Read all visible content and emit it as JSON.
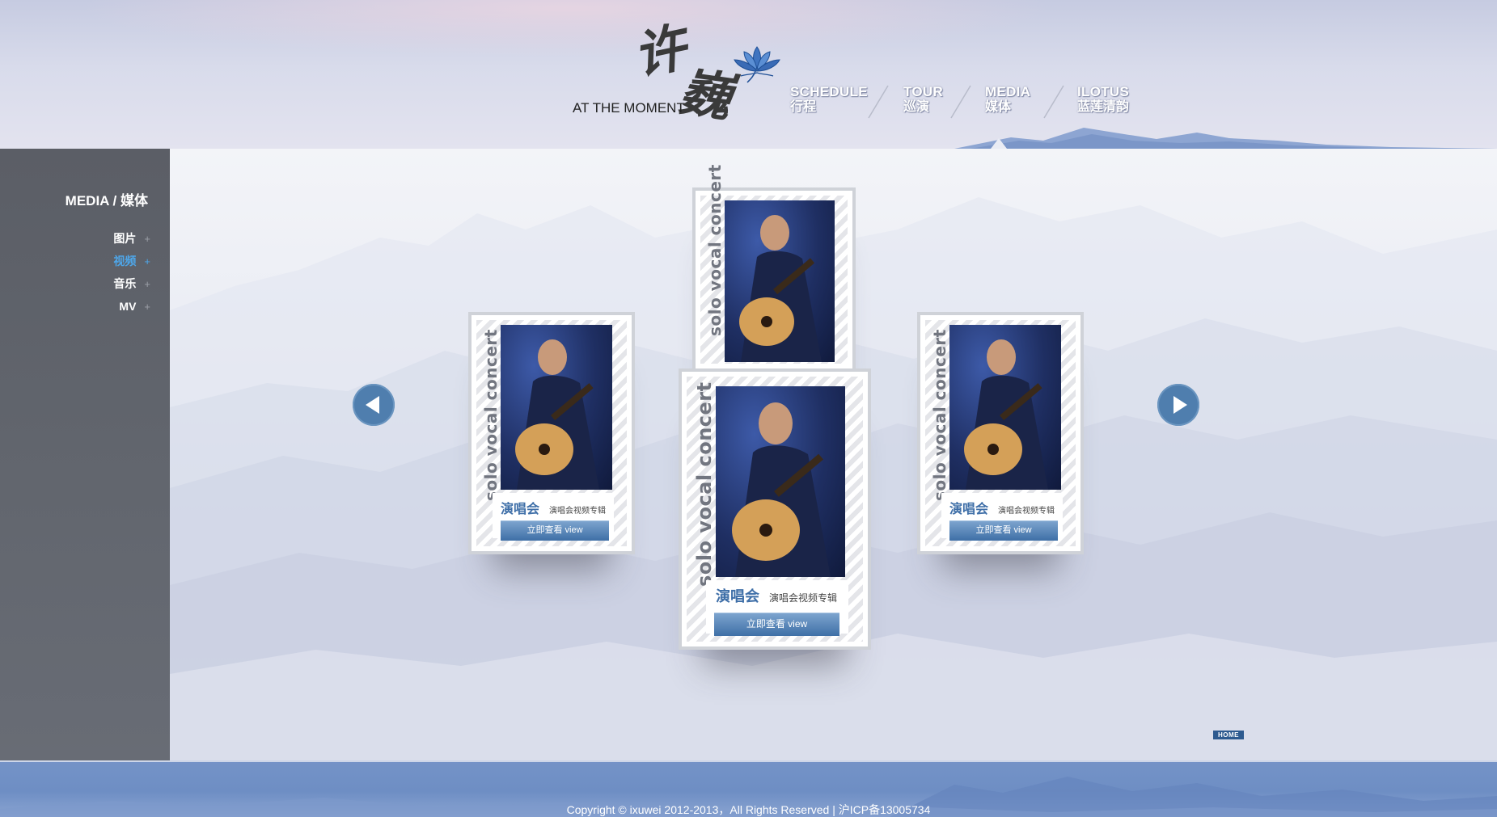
{
  "header": {
    "logo_cn_1": "许",
    "logo_cn_2": "巍",
    "logo_tagline": "AT THE MOMENT",
    "nav": [
      {
        "en": "SCHEDULE",
        "zh": "行程"
      },
      {
        "en": "TOUR",
        "zh": "巡演"
      },
      {
        "en": "MEDIA",
        "zh": "媒体"
      },
      {
        "en": "ILOTUS",
        "zh": "蓝莲清韵"
      }
    ],
    "active_nav": "MEDIA"
  },
  "sidebar": {
    "title": "MEDIA / 媒体",
    "items": [
      {
        "label": "图片",
        "icon": "+"
      },
      {
        "label": "视频",
        "icon": "+"
      },
      {
        "label": "音乐",
        "icon": "+"
      },
      {
        "label": "MV",
        "icon": "+"
      }
    ],
    "active_item": "视频"
  },
  "carousel": {
    "prev_icon": "arrow-left-icon",
    "next_icon": "arrow-right-icon",
    "cards": [
      {
        "vertical_text": "solo vocal concert",
        "title": "演唱会",
        "subtitle": "演唱会视频专辑",
        "button": "立即查看 view"
      },
      {
        "vertical_text": "solo vocal concert",
        "title": "演唱会",
        "subtitle": "演唱会视频专辑",
        "button": "立即查看 view"
      },
      {
        "vertical_text": "solo vocal concert",
        "title": "演唱会",
        "subtitle": "演唱会视频专辑",
        "button": "立即查看 view"
      },
      {
        "vertical_text": "solo vocal concert",
        "title": "演唱会",
        "subtitle": "演唱会视频专辑",
        "button": "立即查看 view"
      }
    ]
  },
  "home_badge": "HOME",
  "footer": {
    "copyright": "Copyright © ixuwei 2012-2013，All Rights Reserved | 沪ICP备13005734"
  },
  "colors": {
    "accent_blue": "#4f7eae",
    "active_item": "#4ea6e9",
    "sidebar_bg": "#5b5e66",
    "footer_bg": "#7493c7"
  }
}
